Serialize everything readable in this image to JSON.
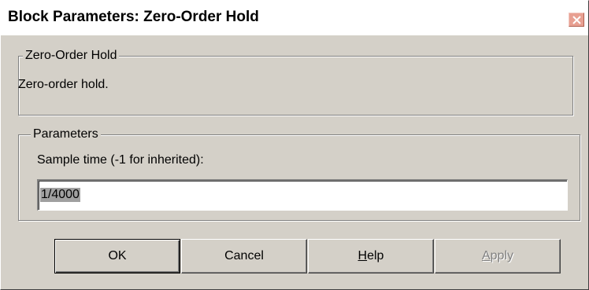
{
  "window": {
    "title": "Block Parameters: Zero-Order Hold",
    "close_icon": "close-icon"
  },
  "description_group": {
    "legend": "Zero-Order Hold",
    "text": "Zero-order hold."
  },
  "parameters_group": {
    "legend": "Parameters",
    "sample_time_label": "Sample time (-1 for inherited):",
    "sample_time_value": "1/4000"
  },
  "buttons": {
    "ok": "OK",
    "cancel": "Cancel",
    "help": "Help",
    "apply": "Apply"
  },
  "colors": {
    "dialog_face": "#d4d0c8",
    "close_button": "#e8a092",
    "selection": "#a0a0a0"
  }
}
